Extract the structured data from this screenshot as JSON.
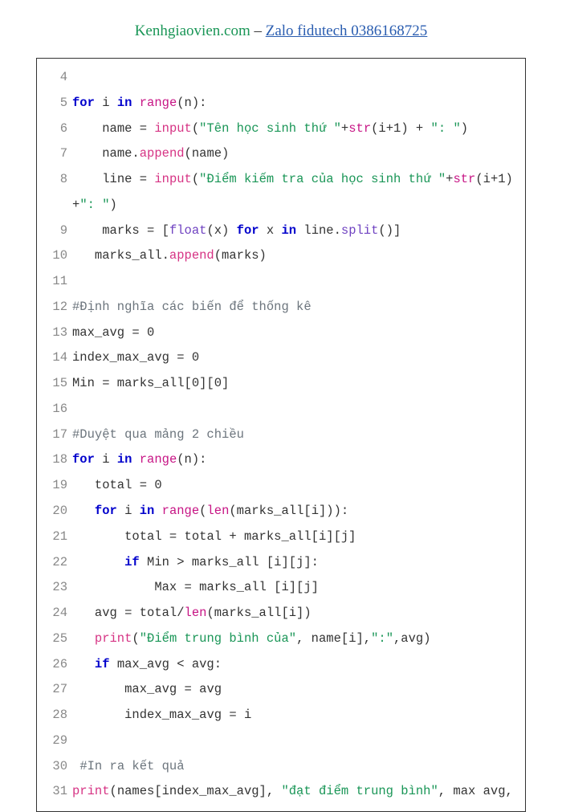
{
  "header": {
    "site": "Kenhgiaovien.com",
    "dash": " – ",
    "zalo": "Zalo fidutech 0386168725"
  },
  "lines": {
    "l4": {
      "num": "4",
      "code": ""
    },
    "l5": {
      "num": "5",
      "parts": {
        "kw1": "for",
        "sp1": " i ",
        "kw2": "in",
        "sp2": " ",
        "fn": "range",
        "rest": "(n):"
      }
    },
    "l6": {
      "num": "6",
      "parts": {
        "indent": "    name = ",
        "fn": "input",
        "p1": "(",
        "str": "\"Tên học sinh thứ \"",
        "plus": "+",
        "strfn": "str",
        "rest": "(i+1) + ",
        "str2": "\": \"",
        "close": ")"
      }
    },
    "l7": {
      "num": "7",
      "parts": {
        "indent": "    name.",
        "fn": "append",
        "rest": "(name)"
      }
    },
    "l8": {
      "num": "8",
      "parts": {
        "indent": "    line = ",
        "fn": "input",
        "p1": "(",
        "str": "\"Điểm kiếm tra của học sinh thứ \"",
        "plus": "+",
        "strfn": "str",
        "rest2": "(i+1)+",
        "str2": "\": \"",
        "close": ")"
      }
    },
    "l9": {
      "num": "9",
      "parts": {
        "indent": "    marks = [",
        "fn": "float",
        "mid": "(x) ",
        "kw1": "for",
        "sp1": " x ",
        "kw2": "in",
        "sp2": " line.",
        "fn2": "split",
        "rest": "()]"
      }
    },
    "l10": {
      "num": "10",
      "parts": {
        "indent": "   marks_all.",
        "fn": "append",
        "rest": "(marks)"
      }
    },
    "l11": {
      "num": "11",
      "code": ""
    },
    "l12": {
      "num": "12",
      "cmt": "#Định nghĩa các biến để thống kê"
    },
    "l13": {
      "num": "13",
      "code": "max_avg = 0"
    },
    "l14": {
      "num": "14",
      "code": "index_max_avg = 0"
    },
    "l15": {
      "num": "15",
      "code": "Min = marks_all[0][0]"
    },
    "l16": {
      "num": "16",
      "code": ""
    },
    "l17": {
      "num": "17",
      "cmt": "#Duyệt qua mảng 2 chiều"
    },
    "l18": {
      "num": "18",
      "parts": {
        "kw1": "for",
        "sp1": " i ",
        "kw2": "in",
        "sp2": " ",
        "fn": "range",
        "rest": "(n):"
      }
    },
    "l19": {
      "num": "19",
      "code": "   total = 0"
    },
    "l20": {
      "num": "20",
      "parts": {
        "indent": "   ",
        "kw1": "for",
        "sp1": " i ",
        "kw2": "in",
        "sp2": " ",
        "fn": "range",
        "p1": "(",
        "fn2": "len",
        "rest": "(marks_all[i])):"
      }
    },
    "l21": {
      "num": "21",
      "code": "       total = total + marks_all[i][j]"
    },
    "l22": {
      "num": "22",
      "parts": {
        "indent": "       ",
        "kw1": "if",
        "rest": " Min > marks_all [i][j]:"
      }
    },
    "l23": {
      "num": "23",
      "code": "           Max = marks_all [i][j]"
    },
    "l24": {
      "num": "24",
      "parts": {
        "indent": "   avg = total/",
        "fn": "len",
        "rest": "(marks_all[i])"
      }
    },
    "l25": {
      "num": "25",
      "parts": {
        "indent": "   ",
        "fn": "print",
        "p1": "(",
        "str": "\"Điểm trung bình của\"",
        "mid": ", name[i],",
        "str2": "\":\"",
        "rest": ",avg)"
      }
    },
    "l26": {
      "num": "26",
      "parts": {
        "indent": "   ",
        "kw1": "if",
        "rest": " max_avg < avg:"
      }
    },
    "l27": {
      "num": "27",
      "code": "       max_avg = avg"
    },
    "l28": {
      "num": "28",
      "code": "       index_max_avg = i"
    },
    "l29": {
      "num": "29",
      "code": ""
    },
    "l30": {
      "num": "30",
      "indent": " ",
      "cmt": "#In ra kết quả"
    },
    "l31": {
      "num": "31",
      "parts": {
        "fn": "print",
        "p1": "(names[index_max_avg], ",
        "str": "\"đạt điểm trung bình\"",
        "rest": ", max avg,"
      }
    }
  }
}
